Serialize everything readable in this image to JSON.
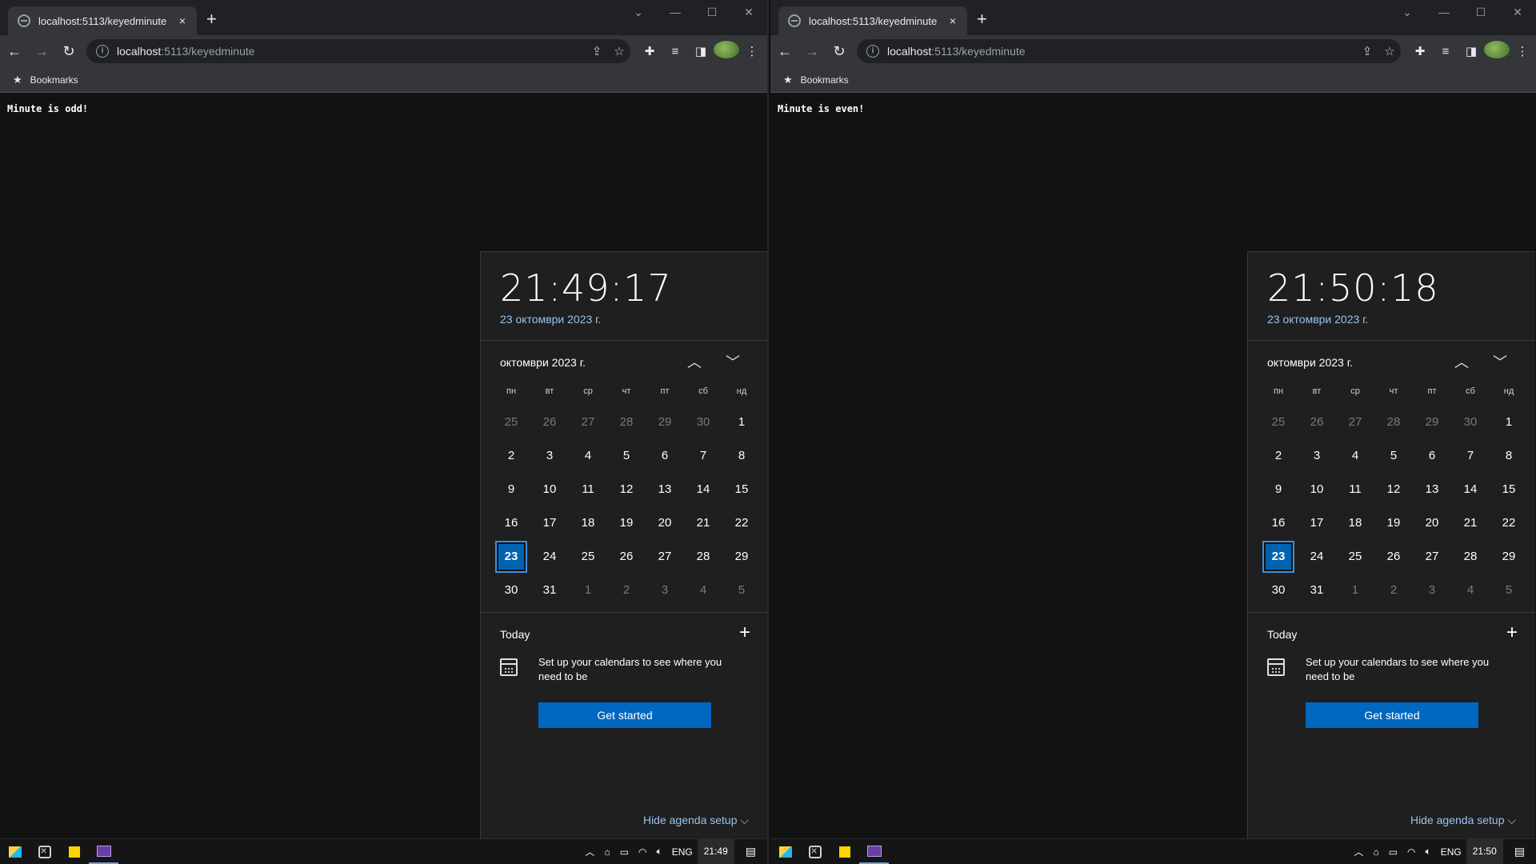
{
  "panels": [
    {
      "tab_title": "localhost:5113/keyedminute",
      "tab_close": "×",
      "new_tab": "+",
      "window_controls": [
        "⌄",
        "—",
        "☐",
        "✕"
      ],
      "url_host": "localhost",
      "url_path": ":5113/keyedminute",
      "bookmarks_label": "Bookmarks",
      "message": "Minute is odd!",
      "clock": {
        "time": "21:49:17",
        "date": "23 октомври 2023 г.",
        "month_label": "октомври 2023 г.",
        "weekdays": [
          "пн",
          "вт",
          "ср",
          "чт",
          "пт",
          "сб",
          "нд"
        ],
        "today_label": "Today",
        "setup_text": "Set up your calendars to see where you need to be",
        "get_started": "Get started",
        "hide_agenda": "Hide agenda setup ⌵"
      },
      "taskbar": {
        "lang": "ENG",
        "time": "21:49"
      }
    },
    {
      "tab_title": "localhost:5113/keyedminute",
      "tab_close": "×",
      "new_tab": "+",
      "window_controls": [
        "⌄",
        "—",
        "☐",
        "✕"
      ],
      "url_host": "localhost",
      "url_path": ":5113/keyedminute",
      "bookmarks_label": "Bookmarks",
      "message": "Minute is even!",
      "clock": {
        "time": "21:50:18",
        "date": "23 октомври 2023 г.",
        "month_label": "октомври 2023 г.",
        "weekdays": [
          "пн",
          "вт",
          "ср",
          "чт",
          "пт",
          "сб",
          "нд"
        ],
        "today_label": "Today",
        "setup_text": "Set up your calendars to see where you need to be",
        "get_started": "Get started",
        "hide_agenda": "Hide agenda setup ⌵"
      },
      "taskbar": {
        "lang": "ENG",
        "time": "21:50"
      }
    }
  ],
  "calendar_days": [
    {
      "d": "25",
      "out": true
    },
    {
      "d": "26",
      "out": true
    },
    {
      "d": "27",
      "out": true
    },
    {
      "d": "28",
      "out": true
    },
    {
      "d": "29",
      "out": true
    },
    {
      "d": "30",
      "out": true
    },
    {
      "d": "1",
      "out": false
    },
    {
      "d": "2",
      "out": false
    },
    {
      "d": "3",
      "out": false
    },
    {
      "d": "4",
      "out": false
    },
    {
      "d": "5",
      "out": false
    },
    {
      "d": "6",
      "out": false
    },
    {
      "d": "7",
      "out": false
    },
    {
      "d": "8",
      "out": false
    },
    {
      "d": "9",
      "out": false
    },
    {
      "d": "10",
      "out": false
    },
    {
      "d": "11",
      "out": false
    },
    {
      "d": "12",
      "out": false
    },
    {
      "d": "13",
      "out": false
    },
    {
      "d": "14",
      "out": false
    },
    {
      "d": "15",
      "out": false
    },
    {
      "d": "16",
      "out": false
    },
    {
      "d": "17",
      "out": false
    },
    {
      "d": "18",
      "out": false
    },
    {
      "d": "19",
      "out": false
    },
    {
      "d": "20",
      "out": false
    },
    {
      "d": "21",
      "out": false
    },
    {
      "d": "22",
      "out": false
    },
    {
      "d": "23",
      "out": false,
      "today": true
    },
    {
      "d": "24",
      "out": false
    },
    {
      "d": "25",
      "out": false
    },
    {
      "d": "26",
      "out": false
    },
    {
      "d": "27",
      "out": false
    },
    {
      "d": "28",
      "out": false
    },
    {
      "d": "29",
      "out": false
    },
    {
      "d": "30",
      "out": false
    },
    {
      "d": "31",
      "out": false
    },
    {
      "d": "1",
      "out": true
    },
    {
      "d": "2",
      "out": true
    },
    {
      "d": "3",
      "out": true
    },
    {
      "d": "4",
      "out": true
    },
    {
      "d": "5",
      "out": true
    }
  ],
  "colors": {
    "accent": "#0067c0",
    "date_link": "#99c3ee",
    "chrome_bg": "#35363a"
  }
}
